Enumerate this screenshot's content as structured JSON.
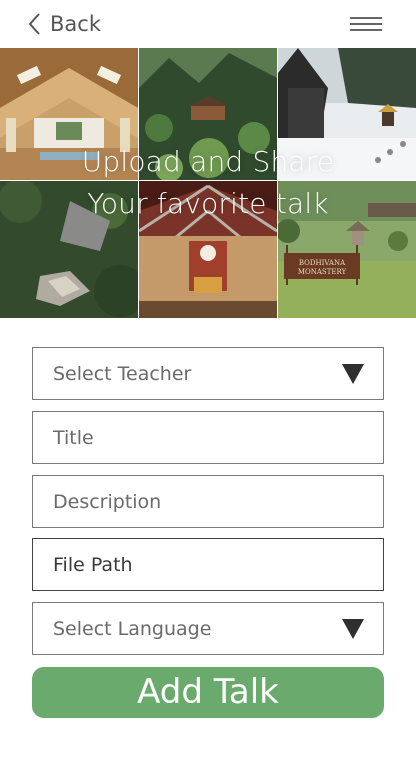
{
  "header": {
    "back_label": "Back",
    "back_icon": "chevron-left-icon",
    "menu_icon": "hamburger-menu-icon"
  },
  "hero": {
    "line1": "Upload and Share",
    "line2": "Your favorite talk",
    "sign_text": "BODHIVANA MONASTERY"
  },
  "form": {
    "teacher_placeholder": "Select Teacher",
    "title_placeholder": "Title",
    "description_placeholder": "Description",
    "file_path_placeholder": "File Path",
    "language_placeholder": "Select Language",
    "dropdown_icon": "triangle-down-icon",
    "submit_label": "Add Talk"
  },
  "colors": {
    "accent": "#6aaa6d",
    "border": "#7a7a7a",
    "text": "#6a6a6a"
  }
}
